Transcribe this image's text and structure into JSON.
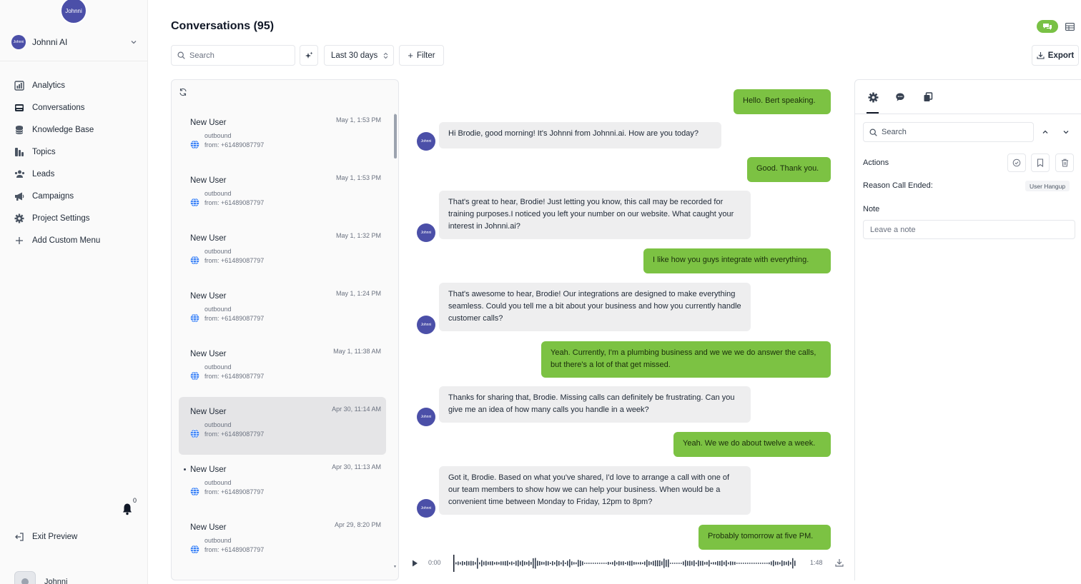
{
  "sidebar": {
    "logo_text": "Johnni",
    "workspace": {
      "name": "Johnni AI",
      "avatar_text": "Johnni"
    },
    "nav": [
      {
        "label": "Analytics",
        "icon": "analytics-icon"
      },
      {
        "label": "Conversations",
        "icon": "inbox-icon"
      },
      {
        "label": "Knowledge Base",
        "icon": "database-icon"
      },
      {
        "label": "Topics",
        "icon": "topics-icon"
      },
      {
        "label": "Leads",
        "icon": "users-icon"
      },
      {
        "label": "Campaigns",
        "icon": "megaphone-icon"
      },
      {
        "label": "Project Settings",
        "icon": "gear-icon"
      },
      {
        "label": "Add Custom Menu",
        "icon": "plus-icon"
      }
    ],
    "notification_count": "0",
    "exit_label": "Exit Preview",
    "user_name": "Johnni"
  },
  "header": {
    "title": "Conversations (95)",
    "search_placeholder": "Search",
    "date_range": "Last 30 days",
    "filter_label": "Filter",
    "export_label": "Export"
  },
  "conversations": [
    {
      "name": "New User",
      "time": "May 1, 1:53 PM",
      "direction": "outbound",
      "from": "from: +61489087797"
    },
    {
      "name": "New User",
      "time": "May 1, 1:53 PM",
      "direction": "outbound",
      "from": "from: +61489087797"
    },
    {
      "name": "New User",
      "time": "May 1, 1:32 PM",
      "direction": "outbound",
      "from": "from: +61489087797"
    },
    {
      "name": "New User",
      "time": "May 1, 1:24 PM",
      "direction": "outbound",
      "from": "from: +61489087797"
    },
    {
      "name": "New User",
      "time": "May 1, 11:38 AM",
      "direction": "outbound",
      "from": "from: +61489087797"
    },
    {
      "name": "New User",
      "time": "Apr 30, 11:14 AM",
      "direction": "outbound",
      "from": "from: +61489087797"
    },
    {
      "name": "New User",
      "time": "Apr 30, 11:13 AM",
      "direction": "outbound",
      "from": "from: +61489087797"
    },
    {
      "name": "New User",
      "time": "Apr 29, 8:20 PM",
      "direction": "outbound",
      "from": "from: +61489087797"
    }
  ],
  "selected_conversation_index": 5,
  "chat": {
    "bot_avatar_text": "Johnni",
    "messages": [
      {
        "role": "user",
        "text": "Hello. Bert speaking."
      },
      {
        "role": "bot",
        "text": "Hi Brodie, good morning! It's Johnni from Johnni.ai. How are you today?"
      },
      {
        "role": "user",
        "text": "Good. Thank you."
      },
      {
        "role": "bot",
        "text": "That's great to hear, Brodie! Just letting you know, this call may be recorded for training purposes.I noticed you left your number on our website. What caught your interest in Johnni.ai?"
      },
      {
        "role": "user",
        "text": "I like how you guys integrate with everything."
      },
      {
        "role": "bot",
        "text": "That's awesome to hear, Brodie! Our integrations are designed to make everything seamless. Could you tell me a bit about your business and how you currently handle customer calls?"
      },
      {
        "role": "user",
        "text": "Yeah. Currently, I'm a plumbing business and we we we do answer the calls, but there's a lot of that get missed."
      },
      {
        "role": "bot",
        "text": "Thanks for sharing that, Brodie. Missing calls can definitely be frustrating. Can you give me an idea of how many calls you handle in a week?"
      },
      {
        "role": "user",
        "text": "Yeah. We we do about twelve a week."
      },
      {
        "role": "bot",
        "text": "Got it, Brodie. Based on what you've shared, I'd love to arrange a call with one of our team members to show how we can help your business. When would be a convenient time between Monday to Friday, 12pm to 8pm?"
      },
      {
        "role": "user",
        "text": "Probably tomorrow at five PM."
      }
    ]
  },
  "audio": {
    "current_time": "0:00",
    "duration": "1:48",
    "progress": 0
  },
  "details": {
    "search_placeholder": "Search",
    "actions_label": "Actions",
    "reason_label": "Reason Call Ended:",
    "reason_value": "User Hangup",
    "note_label": "Note",
    "note_placeholder": "Leave a note"
  },
  "colors": {
    "user_bubble": "#7cc243",
    "bot_bubble": "#eeeeef",
    "brand": "#4b4fa8",
    "toggle_active": "#79c145"
  }
}
